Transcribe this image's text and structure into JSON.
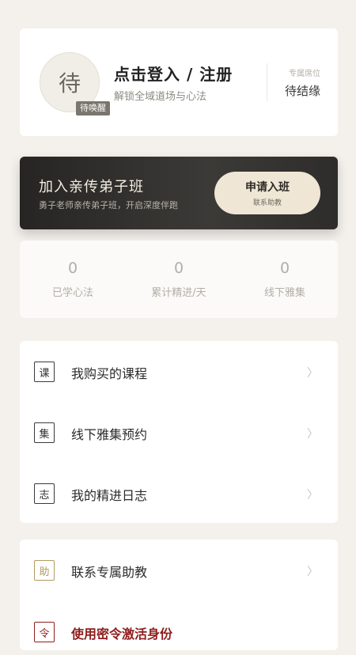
{
  "profile": {
    "avatar_char": "待",
    "avatar_badge": "待唤醒",
    "login_title": "点击登入 / 注册",
    "login_subtitle": "解锁全域道场与心法",
    "seat_label": "专属席位",
    "seat_value": "待结缘"
  },
  "promo": {
    "title": "加入亲传弟子班",
    "subtitle": "勇子老师亲传弟子班，开启深度伴跑",
    "button_label": "申请入班",
    "button_sublabel": "联系助教"
  },
  "stats": [
    {
      "value": "0",
      "label": "已学心法"
    },
    {
      "value": "0",
      "label": "累计精进/天"
    },
    {
      "value": "0",
      "label": "线下雅集"
    }
  ],
  "menu": {
    "items": [
      {
        "icon": "课",
        "label": "我购买的课程"
      },
      {
        "icon": "集",
        "label": "线下雅集预约"
      },
      {
        "icon": "志",
        "label": "我的精进日志"
      }
    ],
    "items2": [
      {
        "icon": "助",
        "label": "联系专属助教"
      },
      {
        "icon": "令",
        "label": "使用密令激活身份"
      }
    ],
    "chevron": "〉"
  },
  "colors": {
    "background": "#f4f1ec",
    "promo_dark": "#2e2d2b",
    "promo_button": "#efe6d6",
    "assist_icon": "#b59a5e",
    "token_red": "#8f1d1d"
  }
}
